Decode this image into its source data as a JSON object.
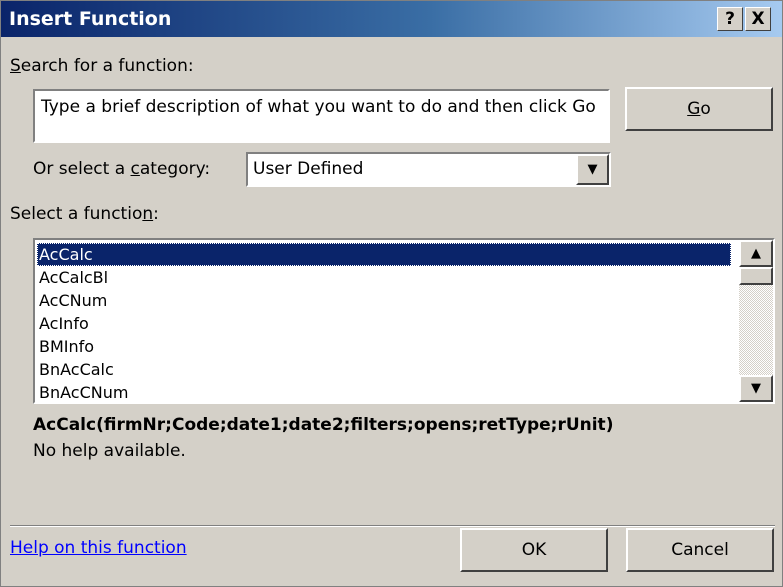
{
  "dialog": {
    "title": "Insert Function",
    "help_button": "?",
    "close_button": "X"
  },
  "search": {
    "label_pre": "",
    "label_accel": "S",
    "label_post": "earch for a function:",
    "value": "Type a brief description of what you want to do and then click Go",
    "go_pre": "",
    "go_accel": "G",
    "go_post": "o"
  },
  "category": {
    "label_pre": "Or select a ",
    "label_accel": "c",
    "label_post": "ategory:",
    "selected": "User Defined"
  },
  "functions": {
    "label_pre": "Select a functio",
    "label_accel": "n",
    "label_post": ":",
    "items": [
      "AcCalc",
      "AcCalcBl",
      "AcCNum",
      "AcInfo",
      "BMInfo",
      "BnAcCalc",
      "BnAcCNum"
    ],
    "selected_index": 0
  },
  "details": {
    "signature": "AcCalc(firmNr;Code;date1;date2;filters;opens;retType;rUnit)",
    "description": "No help available."
  },
  "footer": {
    "help_link": "Help on this function",
    "ok": "OK",
    "cancel": "Cancel"
  }
}
